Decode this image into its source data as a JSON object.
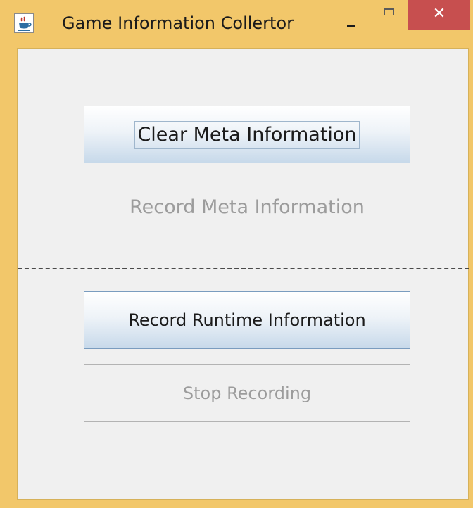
{
  "window": {
    "title": "Game Information Collertor",
    "icon": "java-coffee-icon",
    "close_symbol": "✕",
    "colors": {
      "frame": "#f2c76a",
      "close_button": "#c74f4f",
      "client_background": "#f0f0f0"
    }
  },
  "buttons": {
    "clear_meta": {
      "label": "Clear Meta Information",
      "enabled": true,
      "focused": true
    },
    "record_meta": {
      "label": "Record Meta Information",
      "enabled": false
    },
    "record_runtime": {
      "label": "Record Runtime Information",
      "enabled": true
    },
    "stop_recording": {
      "label": "Stop Recording",
      "enabled": false
    }
  }
}
